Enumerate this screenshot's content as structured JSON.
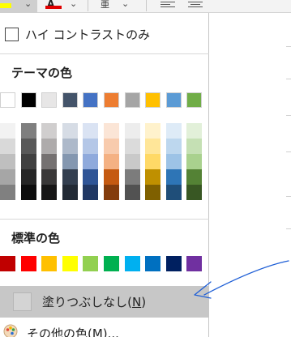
{
  "ribbon": {
    "highlight_chevron": "⌄",
    "font_color_label": "A",
    "font_color_chevron": "⌄",
    "phonetic_label": "亜",
    "phonetic_chevron": "⌄",
    "highlight_color": "#ffff00",
    "font_color": "#e00000"
  },
  "menu": {
    "high_contrast_label": "ハイ コントラストのみ",
    "theme_colors_title": "テーマの色",
    "standard_colors_title": "標準の色",
    "no_fill_label": "塗りつぶしなし(",
    "no_fill_key": "N",
    "no_fill_suffix": ")",
    "more_colors_label": "その他の色(M)..."
  },
  "theme_colors": [
    {
      "base": "#ffffff",
      "shades": [
        "#f2f2f2",
        "#d9d9d9",
        "#bfbfbf",
        "#a6a6a6",
        "#808080"
      ]
    },
    {
      "base": "#000000",
      "shades": [
        "#7f7f7f",
        "#595959",
        "#404040",
        "#262626",
        "#0d0d0d"
      ]
    },
    {
      "base": "#e7e6e6",
      "shades": [
        "#d0cece",
        "#aeabab",
        "#757171",
        "#3a3838",
        "#171616"
      ]
    },
    {
      "base": "#44546a",
      "shades": [
        "#d6dce5",
        "#adb9ca",
        "#8497b0",
        "#333f50",
        "#222a35"
      ]
    },
    {
      "base": "#4472c4",
      "shades": [
        "#dae3f3",
        "#b4c7e7",
        "#8faadc",
        "#2f5597",
        "#203864"
      ]
    },
    {
      "base": "#ed7d31",
      "shades": [
        "#fbe5d6",
        "#f8cbad",
        "#f4b183",
        "#c55a11",
        "#843c0c"
      ]
    },
    {
      "base": "#a5a5a5",
      "shades": [
        "#ededed",
        "#dbdbdb",
        "#c9c9c9",
        "#7c7c7c",
        "#525252"
      ]
    },
    {
      "base": "#ffc000",
      "shades": [
        "#fff2cc",
        "#ffe699",
        "#ffd966",
        "#bf9000",
        "#7f6000"
      ]
    },
    {
      "base": "#5b9bd5",
      "shades": [
        "#deebf7",
        "#bdd7ee",
        "#9dc3e6",
        "#2e75b6",
        "#1f4e79"
      ]
    },
    {
      "base": "#70ad47",
      "shades": [
        "#e2f0d9",
        "#c5e0b4",
        "#a9d18e",
        "#548235",
        "#385723"
      ]
    }
  ],
  "standard_colors": [
    "#c00000",
    "#ff0000",
    "#ffc000",
    "#ffff00",
    "#92d050",
    "#00b050",
    "#00b0f0",
    "#0070c0",
    "#002060",
    "#7030a0"
  ],
  "annotation_color": "#1f5fd6",
  "icons": {
    "checkbox": "checkbox-icon",
    "palette": "color-palette-icon",
    "no_fill": "no-fill-icon",
    "align_left": "align-left-icon",
    "align_center": "align-center-icon"
  }
}
